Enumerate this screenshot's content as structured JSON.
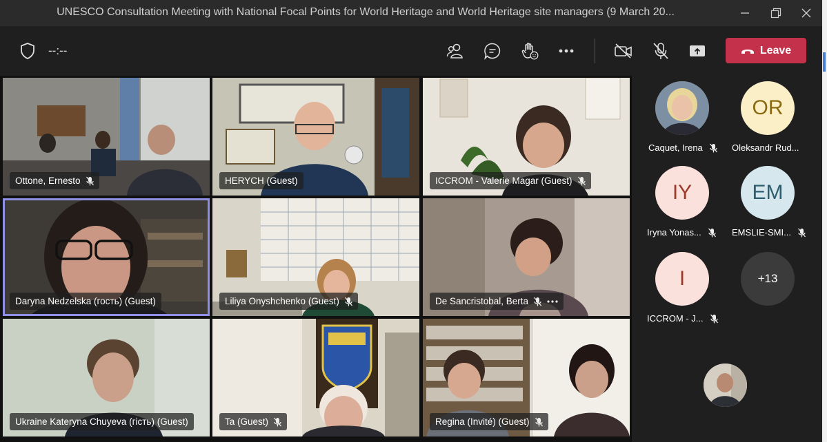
{
  "window": {
    "title": "UNESCO Consultation Meeting with National Focal Points for World Heritage and World Heritage site managers (9 March 20..."
  },
  "toolbar": {
    "timer": "--:--",
    "leave_label": "Leave"
  },
  "tiles": [
    {
      "name": "Ottone, Ernesto",
      "muted": true
    },
    {
      "name": "HERYCH (Guest)",
      "muted": false
    },
    {
      "name": "ICCROM - Valerie Magar (Guest)",
      "muted": true
    },
    {
      "name": "Daryna Nedzelska (гость) (Guest)",
      "muted": false,
      "active": true
    },
    {
      "name": "Liliya Onyshchenko (Guest)",
      "muted": true
    },
    {
      "name": "De Sancristobal, Berta",
      "muted": true,
      "more": true
    },
    {
      "name": "Ukraine Kateryna Chuyeva (гість) (Guest)",
      "muted": false
    },
    {
      "name": "Ta (Guest)",
      "muted": true
    },
    {
      "name": "Regina (Invité) (Guest)",
      "muted": true
    }
  ],
  "roster": [
    {
      "name": "Caquet, Irena",
      "initials": "",
      "muted": true
    },
    {
      "name": "Oleksandr Rud...",
      "initials": "OR",
      "muted": false
    },
    {
      "name": "Iryna Yonas...",
      "initials": "IY",
      "muted": true
    },
    {
      "name": "EMSLIE-SMI...",
      "initials": "EM",
      "muted": true
    },
    {
      "name": "ICCROM - J...",
      "initials": "I",
      "muted": true
    }
  ],
  "more_participants": "+13",
  "colors": {
    "leave": "#c4314b",
    "active_border": "#8f8fe6",
    "avatar_or": "#fbefc8",
    "avatar_pink": "#fbe1dc",
    "avatar_em": "#d6e7ee"
  }
}
